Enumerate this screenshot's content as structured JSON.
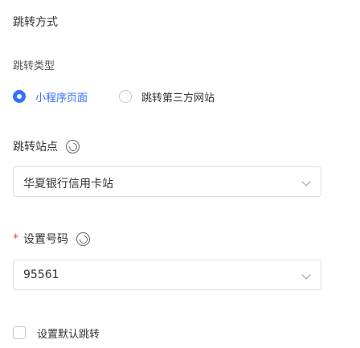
{
  "section": {
    "title": "跳转方式"
  },
  "jump_type": {
    "label": "跳转类型",
    "options": [
      {
        "label": "小程序页面",
        "checked": true
      },
      {
        "label": "跳转第三方网站",
        "checked": false
      }
    ]
  },
  "target_site": {
    "label": "跳转站点",
    "value": "华夏银行信用卡站"
  },
  "phone": {
    "required_mark": "*",
    "label": "设置号码",
    "value": "95561"
  },
  "default_jump": {
    "label": "设置默认跳转",
    "checked": false
  },
  "colors": {
    "accent": "#3370ff",
    "required": "#f54a45",
    "border": "#dcdfe6"
  }
}
